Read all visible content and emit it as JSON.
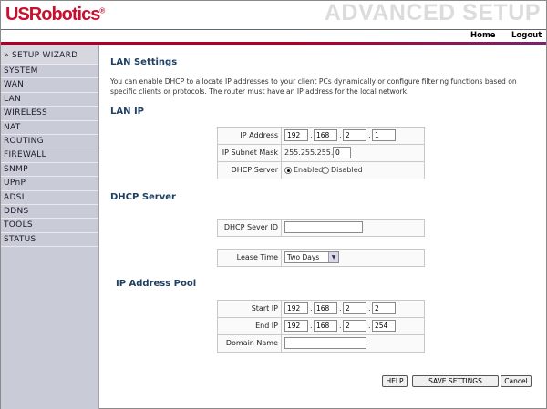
{
  "header": {
    "logo": "USRobotics",
    "logo_mark": "®",
    "banner": "ADVANCED SETUP",
    "nav_home": "Home",
    "nav_logout": "Logout"
  },
  "sidebar": {
    "items": [
      {
        "label": "» SETUP WIZARD",
        "active": true
      },
      {
        "label": "SYSTEM"
      },
      {
        "label": "WAN"
      },
      {
        "label": "LAN"
      },
      {
        "label": "WIRELESS"
      },
      {
        "label": "NAT"
      },
      {
        "label": "ROUTING"
      },
      {
        "label": "FIREWALL"
      },
      {
        "label": "SNMP"
      },
      {
        "label": "UPnP"
      },
      {
        "label": "ADSL"
      },
      {
        "label": "DDNS"
      },
      {
        "label": "TOOLS"
      },
      {
        "label": "STATUS"
      }
    ]
  },
  "main": {
    "title": "LAN Settings",
    "description": "You can enable DHCP to allocate IP addresses to your client PCs dynamically or configure filtering functions based on specific clients or protocols. The router must have an IP address for the local network.",
    "lan_ip": {
      "heading": "LAN IP",
      "ip_label": "IP Address",
      "ip": [
        "192",
        "168",
        "2",
        "1"
      ],
      "mask_label": "IP Subnet Mask",
      "mask_prefix": "255.255.255.",
      "mask_last": "0",
      "dhcp_label": "DHCP Server",
      "enabled_label": "Enabled",
      "disabled_label": "Disabled",
      "dhcp_selected": "Enabled"
    },
    "dhcp_server": {
      "heading": "DHCP Server",
      "id_label": "DHCP Sever ID",
      "id_value": "",
      "lease_label": "Lease Time",
      "lease_value": "Two Days"
    },
    "pool": {
      "heading": "IP Address Pool",
      "start_label": "Start IP",
      "start": [
        "192",
        "168",
        "2",
        "2"
      ],
      "end_label": "End IP",
      "end": [
        "192",
        "168",
        "2",
        "254"
      ],
      "domain_label": "Domain Name",
      "domain_value": ""
    },
    "buttons": {
      "help": "HELP",
      "save": "SAVE SETTINGS",
      "cancel": "Cancel"
    }
  },
  "colors": {
    "brand_red": "#c8102e",
    "sidebar_bg": "#c9cbd6",
    "heading_blue": "#1f3f63"
  }
}
